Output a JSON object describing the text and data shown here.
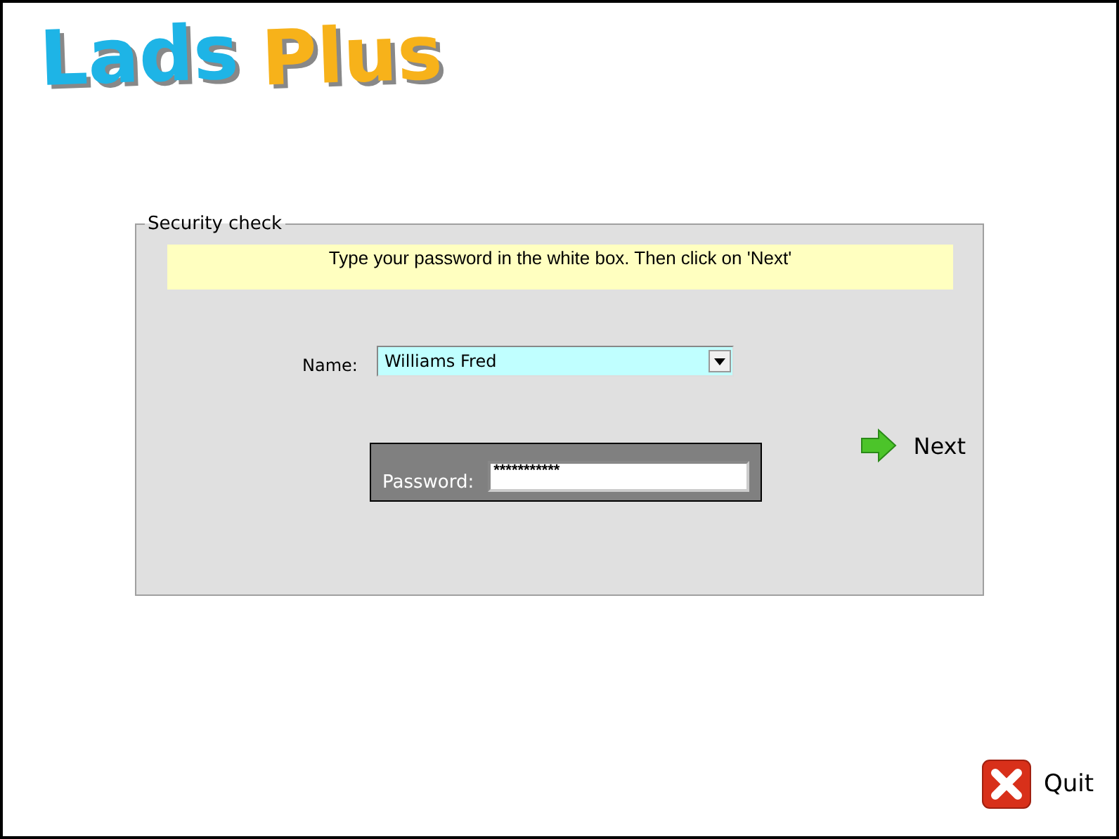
{
  "logo": [
    {
      "text": "Lads",
      "color": "#1eb4e6"
    },
    {
      "text": "Plus",
      "color": "#f7b21a"
    }
  ],
  "panel": {
    "title": "Security check",
    "instruction": "Type your password in the white box. Then click on 'Next'",
    "name_label": "Name:",
    "name_value": "Williams Fred",
    "password_label": "Password:",
    "password_value": "***********",
    "next": "Next"
  },
  "quit": "Quit"
}
